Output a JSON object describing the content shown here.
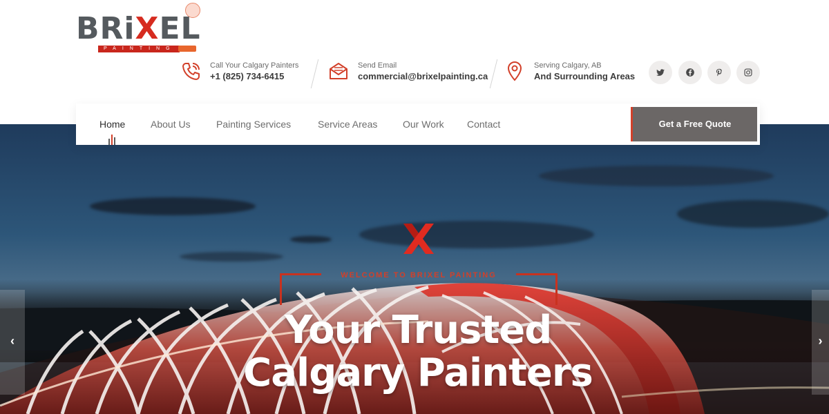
{
  "brand": {
    "logo_text_pre": "BRi",
    "logo_text_x": "X",
    "logo_text_post": "EL",
    "logo_tagline": "PAINTING",
    "accent": "#d2402a"
  },
  "contact": [
    {
      "icon": "phone-icon",
      "label": "Call Your Calgary Painters",
      "value": "+1 (825) 734-6415"
    },
    {
      "icon": "envelope-icon",
      "label": "Send Email",
      "value": "commercial@brixelpainting.ca"
    },
    {
      "icon": "location-pin-icon",
      "label": "Serving Calgary, AB",
      "value": "And Surrounding Areas"
    }
  ],
  "social": [
    "twitter-icon",
    "facebook-icon",
    "pinterest-icon",
    "instagram-icon"
  ],
  "nav": {
    "items": [
      "Home",
      "About Us",
      "Painting Services",
      "Service Areas",
      "Our Work",
      "Contact"
    ],
    "active": "Home",
    "cta_label": "Get a Free Quote"
  },
  "hero": {
    "kicker": "WELCOME TO BRIXEL PAINTING",
    "headline_line1": "Your Trusted",
    "headline_line2": "Calgary Painters",
    "prev_icon": "chevron-left-icon",
    "next_icon": "chevron-right-icon"
  }
}
